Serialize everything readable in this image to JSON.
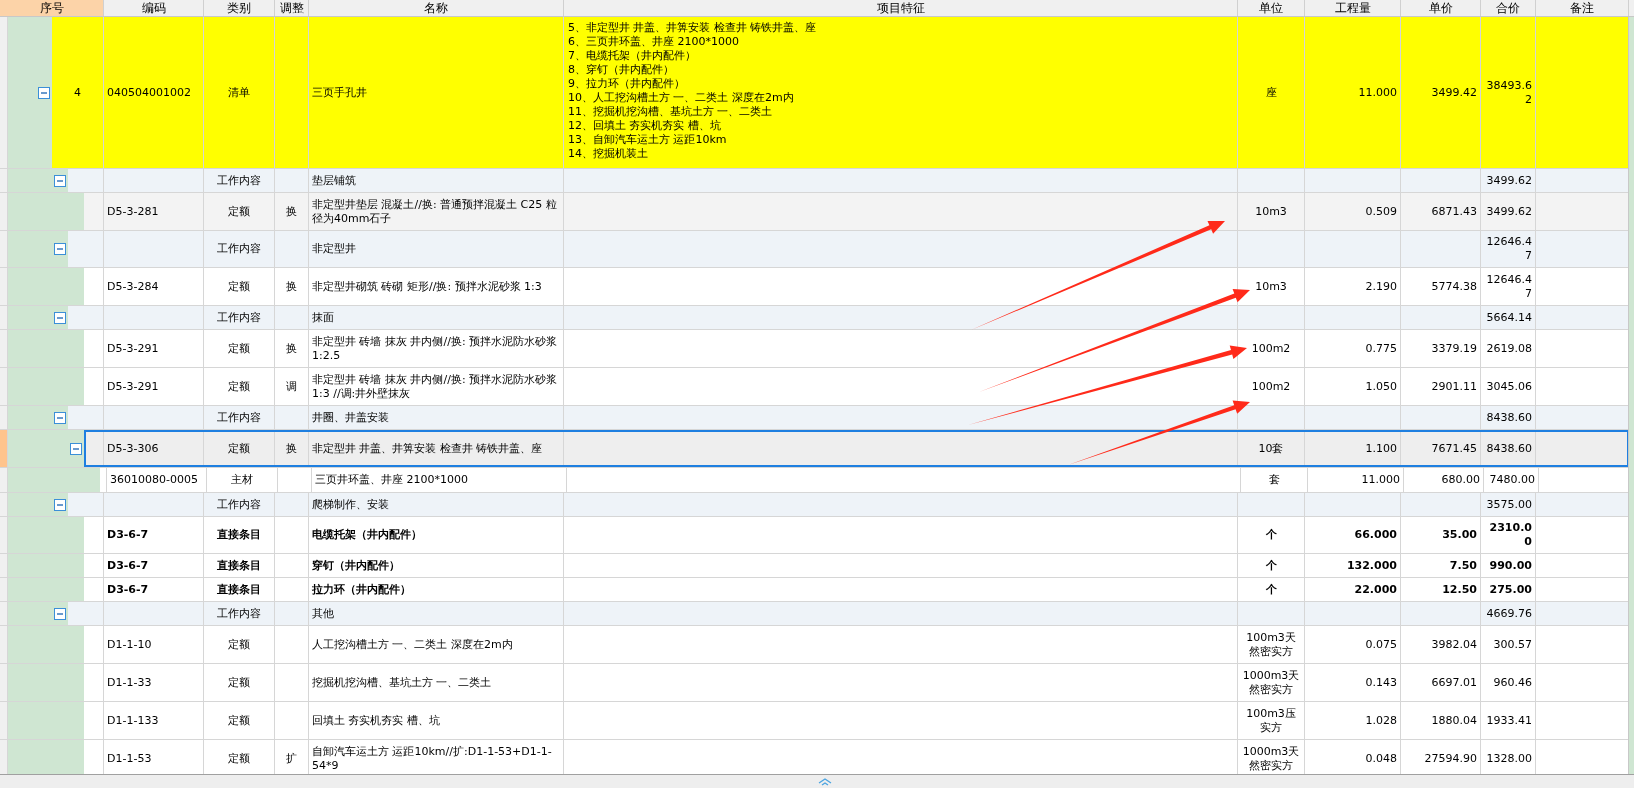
{
  "columns": [
    {
      "label": "序号",
      "selected": true
    },
    {
      "label": "编码",
      "selected": false
    },
    {
      "label": "类别",
      "selected": false
    },
    {
      "label": "调整",
      "selected": false
    },
    {
      "label": "名称",
      "selected": false
    },
    {
      "label": "项目特征",
      "selected": false
    },
    {
      "label": "单位",
      "selected": false
    },
    {
      "label": "工程量",
      "selected": false
    },
    {
      "label": "单价",
      "selected": false
    },
    {
      "label": "合价",
      "selected": false
    },
    {
      "label": "备注",
      "selected": false
    }
  ],
  "rows": [
    {
      "kind": "list",
      "seq": "4",
      "code": "040504001002",
      "category": "清单",
      "name": "三页手孔井",
      "features": [
        "5、非定型井 井盖、井箅安装 检查井 铸铁井盖、座",
        "6、三页井环盖、井座 2100*1000",
        "7、电缆托架（井内配件）",
        "8、穿钉（井内配件）",
        "9、拉力环（井内配件）",
        "10、人工挖沟槽土方 一、二类土 深度在2m内",
        "11、挖掘机挖沟槽、基坑土方 一、二类土",
        "12、回填土 夯实机夯实 槽、坑",
        "13、自卸汽车运土方 运距10km",
        "14、挖掘机装土"
      ],
      "unit": "座",
      "qty": "11.000",
      "price": "3499.42",
      "total": "38493.62",
      "selected": false,
      "shaded": false,
      "expanded": true,
      "children": [
        {
          "kind": "group",
          "category": "工作内容",
          "name": "垫层铺筑",
          "total": "3499.62",
          "selected": false,
          "expanded": true,
          "children": [
            {
              "kind": "quota",
              "code": "D5-3-281",
              "category": "定额",
              "adjust": "换",
              "name": "非定型井垫层 混凝土//换: 普通预拌混凝土 C25 粒径为40mm石子",
              "unit": "10m3",
              "qty": "0.509",
              "price": "6871.43",
              "total": "3499.62",
              "selected": false,
              "shaded": true
            }
          ]
        },
        {
          "kind": "group",
          "category": "工作内容",
          "name": "非定型井",
          "total": "12646.47",
          "selected": false,
          "expanded": true,
          "children": [
            {
              "kind": "quota",
              "code": "D5-3-284",
              "category": "定额",
              "adjust": "换",
              "name": "非定型井砌筑 砖砌 矩形//换: 预拌水泥砂浆 1:3",
              "unit": "10m3",
              "qty": "2.190",
              "price": "5774.38",
              "total": "12646.47",
              "selected": false,
              "shaded": false
            }
          ]
        },
        {
          "kind": "group",
          "category": "工作内容",
          "name": "抹面",
          "total": "5664.14",
          "selected": false,
          "expanded": true,
          "children": [
            {
              "kind": "quota",
              "code": "D5-3-291",
              "category": "定额",
              "adjust": "换",
              "name": "非定型井 砖墙 抹灰 井内侧//换: 预拌水泥防水砂浆 1:2.5",
              "unit": "100m2",
              "qty": "0.775",
              "price": "3379.19",
              "total": "2619.08",
              "selected": false,
              "shaded": false
            },
            {
              "kind": "quota",
              "code": "D5-3-291",
              "category": "定额",
              "adjust": "调",
              "name": "非定型井 砖墙 抹灰 井内侧//换: 预拌水泥防水砂浆 1:3 //调:井外壁抹灰",
              "unit": "100m2",
              "qty": "1.050",
              "price": "2901.11",
              "total": "3045.06",
              "selected": false,
              "shaded": false
            }
          ]
        },
        {
          "kind": "group",
          "category": "工作内容",
          "name": "井圈、井盖安装",
          "total": "8438.60",
          "selected": false,
          "expanded": true,
          "children": [
            {
              "kind": "quota",
              "code": "D5-3-306",
              "category": "定额",
              "adjust": "换",
              "name": "非定型井 井盖、井箅安装 检查井 铸铁井盖、座",
              "unit": "10套",
              "qty": "1.100",
              "price": "7671.45",
              "total": "8438.60",
              "selected": true,
              "expanded": true,
              "children": [
                {
                  "kind": "material",
                  "code": "36010080-0005",
                  "category": "主材",
                  "name": "三页井环盖、井座 2100*1000",
                  "unit": "套",
                  "qty": "11.000",
                  "price": "680.00",
                  "total": "7480.00",
                  "selected": false,
                  "shaded": false
                }
              ]
            }
          ]
        },
        {
          "kind": "group",
          "category": "工作内容",
          "name": "爬梯制作、安装",
          "total": "3575.00",
          "selected": false,
          "expanded": true,
          "children": [
            {
              "kind": "direct",
              "code": "D3-6-7",
              "category": "直接条目",
              "name": "电缆托架（井内配件）",
              "unit": "个",
              "qty": "66.000",
              "price": "35.00",
              "total": "2310.00",
              "selected": false,
              "shaded": false
            },
            {
              "kind": "direct",
              "code": "D3-6-7",
              "category": "直接条目",
              "name": "穿钉（井内配件）",
              "unit": "个",
              "qty": "132.000",
              "price": "7.50",
              "total": "990.00",
              "selected": false,
              "shaded": false
            },
            {
              "kind": "direct",
              "code": "D3-6-7",
              "category": "直接条目",
              "name": "拉力环（井内配件）",
              "unit": "个",
              "qty": "22.000",
              "price": "12.50",
              "total": "275.00",
              "selected": false,
              "shaded": false
            }
          ]
        },
        {
          "kind": "group",
          "category": "工作内容",
          "name": "其他",
          "total": "4669.76",
          "selected": false,
          "expanded": true,
          "children": [
            {
              "kind": "quota",
              "code": "D1-1-10",
              "category": "定额",
              "name": "人工挖沟槽土方 一、二类土 深度在2m内",
              "unit": "100m3天然密实方",
              "qty": "0.075",
              "price": "3982.04",
              "total": "300.57",
              "selected": false,
              "shaded": false
            },
            {
              "kind": "quota",
              "code": "D1-1-33",
              "category": "定额",
              "name": "挖掘机挖沟槽、基坑土方 一、二类土",
              "unit": "1000m3天然密实方",
              "qty": "0.143",
              "price": "6697.01",
              "total": "960.46",
              "selected": false,
              "shaded": false
            },
            {
              "kind": "quota",
              "code": "D1-1-133",
              "category": "定额",
              "name": "回填土 夯实机夯实 槽、坑",
              "unit": "100m3压实方",
              "qty": "1.028",
              "price": "1880.04",
              "total": "1933.41",
              "selected": false,
              "shaded": false
            },
            {
              "kind": "quota",
              "code": "D1-1-53",
              "category": "定额",
              "adjust": "扩",
              "name": "自卸汽车运土方 运距10km//扩:D1-1-53+D1-1-54*9",
              "unit": "1000m3天然密实方",
              "qty": "0.048",
              "price": "27594.90",
              "total": "1328.00",
              "selected": false,
              "shaded": false
            }
          ]
        }
      ]
    }
  ]
}
